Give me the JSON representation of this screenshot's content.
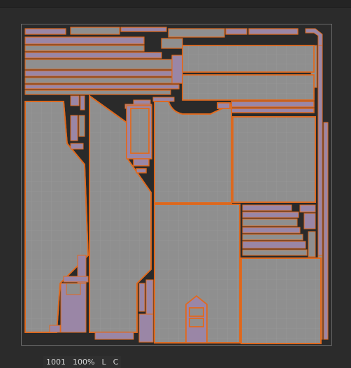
{
  "viewport": {
    "tile": "1001",
    "zoom": "100%",
    "flag_l": "L",
    "flag_c": "C"
  },
  "colors": {
    "background": "#2b2b2b",
    "island_fill": "#8f8f8f",
    "island_edge": "#e06a1e",
    "strip_fill": "#9a86a6",
    "grid_line": "#9c9c9c"
  }
}
